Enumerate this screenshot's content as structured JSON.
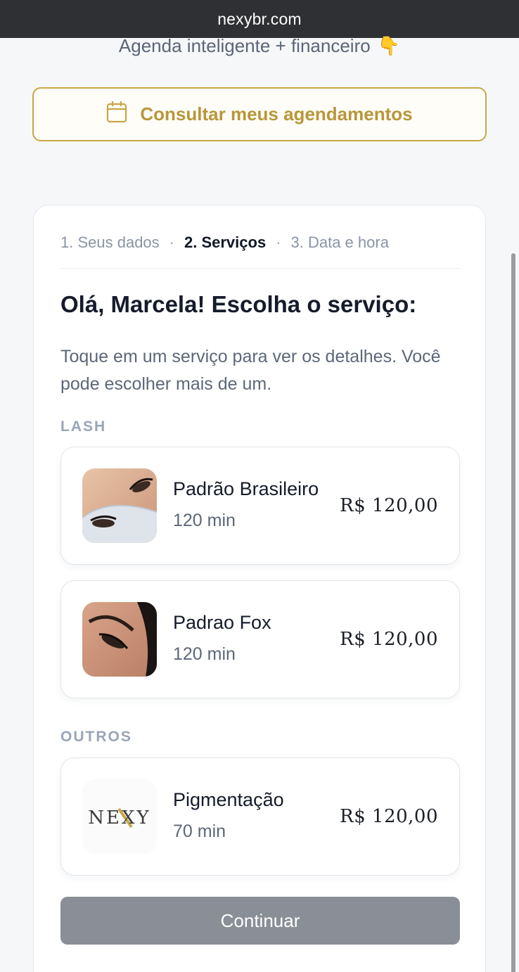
{
  "browser": {
    "url": "nexybr.com"
  },
  "tagline": {
    "text": "Agenda inteligente + financeiro",
    "emoji": "👇"
  },
  "consult_button": {
    "label": "Consultar meus agendamentos",
    "icon": "calendar-icon"
  },
  "steps": {
    "items": [
      {
        "label": "1. Seus dados",
        "active": false
      },
      {
        "label": "2. Serviços",
        "active": true
      },
      {
        "label": "3. Data e hora",
        "active": false
      }
    ],
    "separator": "·"
  },
  "heading": "Olá, Marcela! Escolha o serviço:",
  "subtext": "Toque em um serviço para ver os detalhes. Você pode escolher mais de um.",
  "sections": [
    {
      "label": "LASH",
      "services": [
        {
          "name": "Padrão Brasileiro",
          "duration": "120 min",
          "price": "R$ 120,00",
          "thumb": "eyelash-photo"
        },
        {
          "name": "Padrao Fox",
          "duration": "120 min",
          "price": "R$ 120,00",
          "thumb": "eyelash-photo"
        }
      ]
    },
    {
      "label": "OUTROS",
      "services": [
        {
          "name": "Pigmentação",
          "duration": "70 min",
          "price": "R$ 120,00",
          "thumb": "nexy-logo",
          "logo_text": "NEXY"
        }
      ]
    }
  ],
  "continue_button": {
    "label": "Continuar"
  },
  "colors": {
    "accent_gold": "#c9a646",
    "disabled_button": "#8a8e96",
    "url_bar": "#2f3033"
  }
}
